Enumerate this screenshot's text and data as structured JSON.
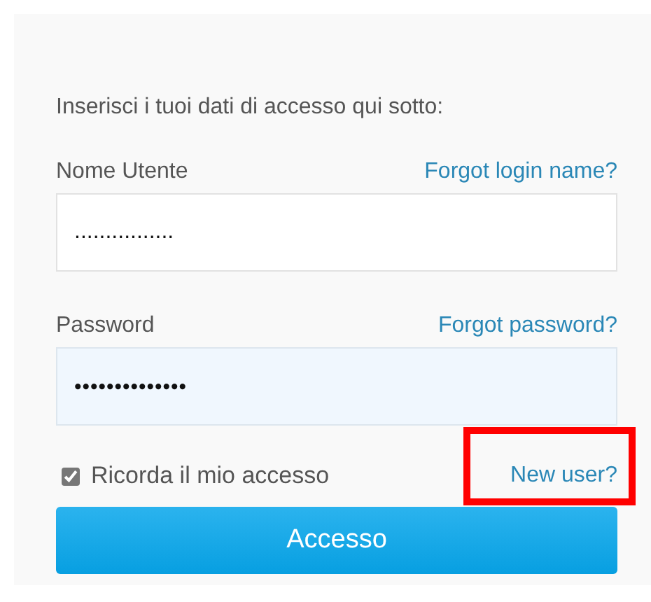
{
  "intro": "Inserisci i tuoi dati di accesso qui sotto:",
  "fields": [
    {
      "kind": "text",
      "label": "Nome Utente",
      "link": "Forgot login name?",
      "value": "................",
      "focused": false
    },
    {
      "kind": "password",
      "label": "Password",
      "link": "Forgot password?",
      "value": "••••••••••••••",
      "focused": true
    }
  ],
  "remember": {
    "label": "Ricorda il mio accesso",
    "checked": true
  },
  "new_user": {
    "label": "New user?",
    "highlighted": true
  },
  "submit": "Accesso"
}
